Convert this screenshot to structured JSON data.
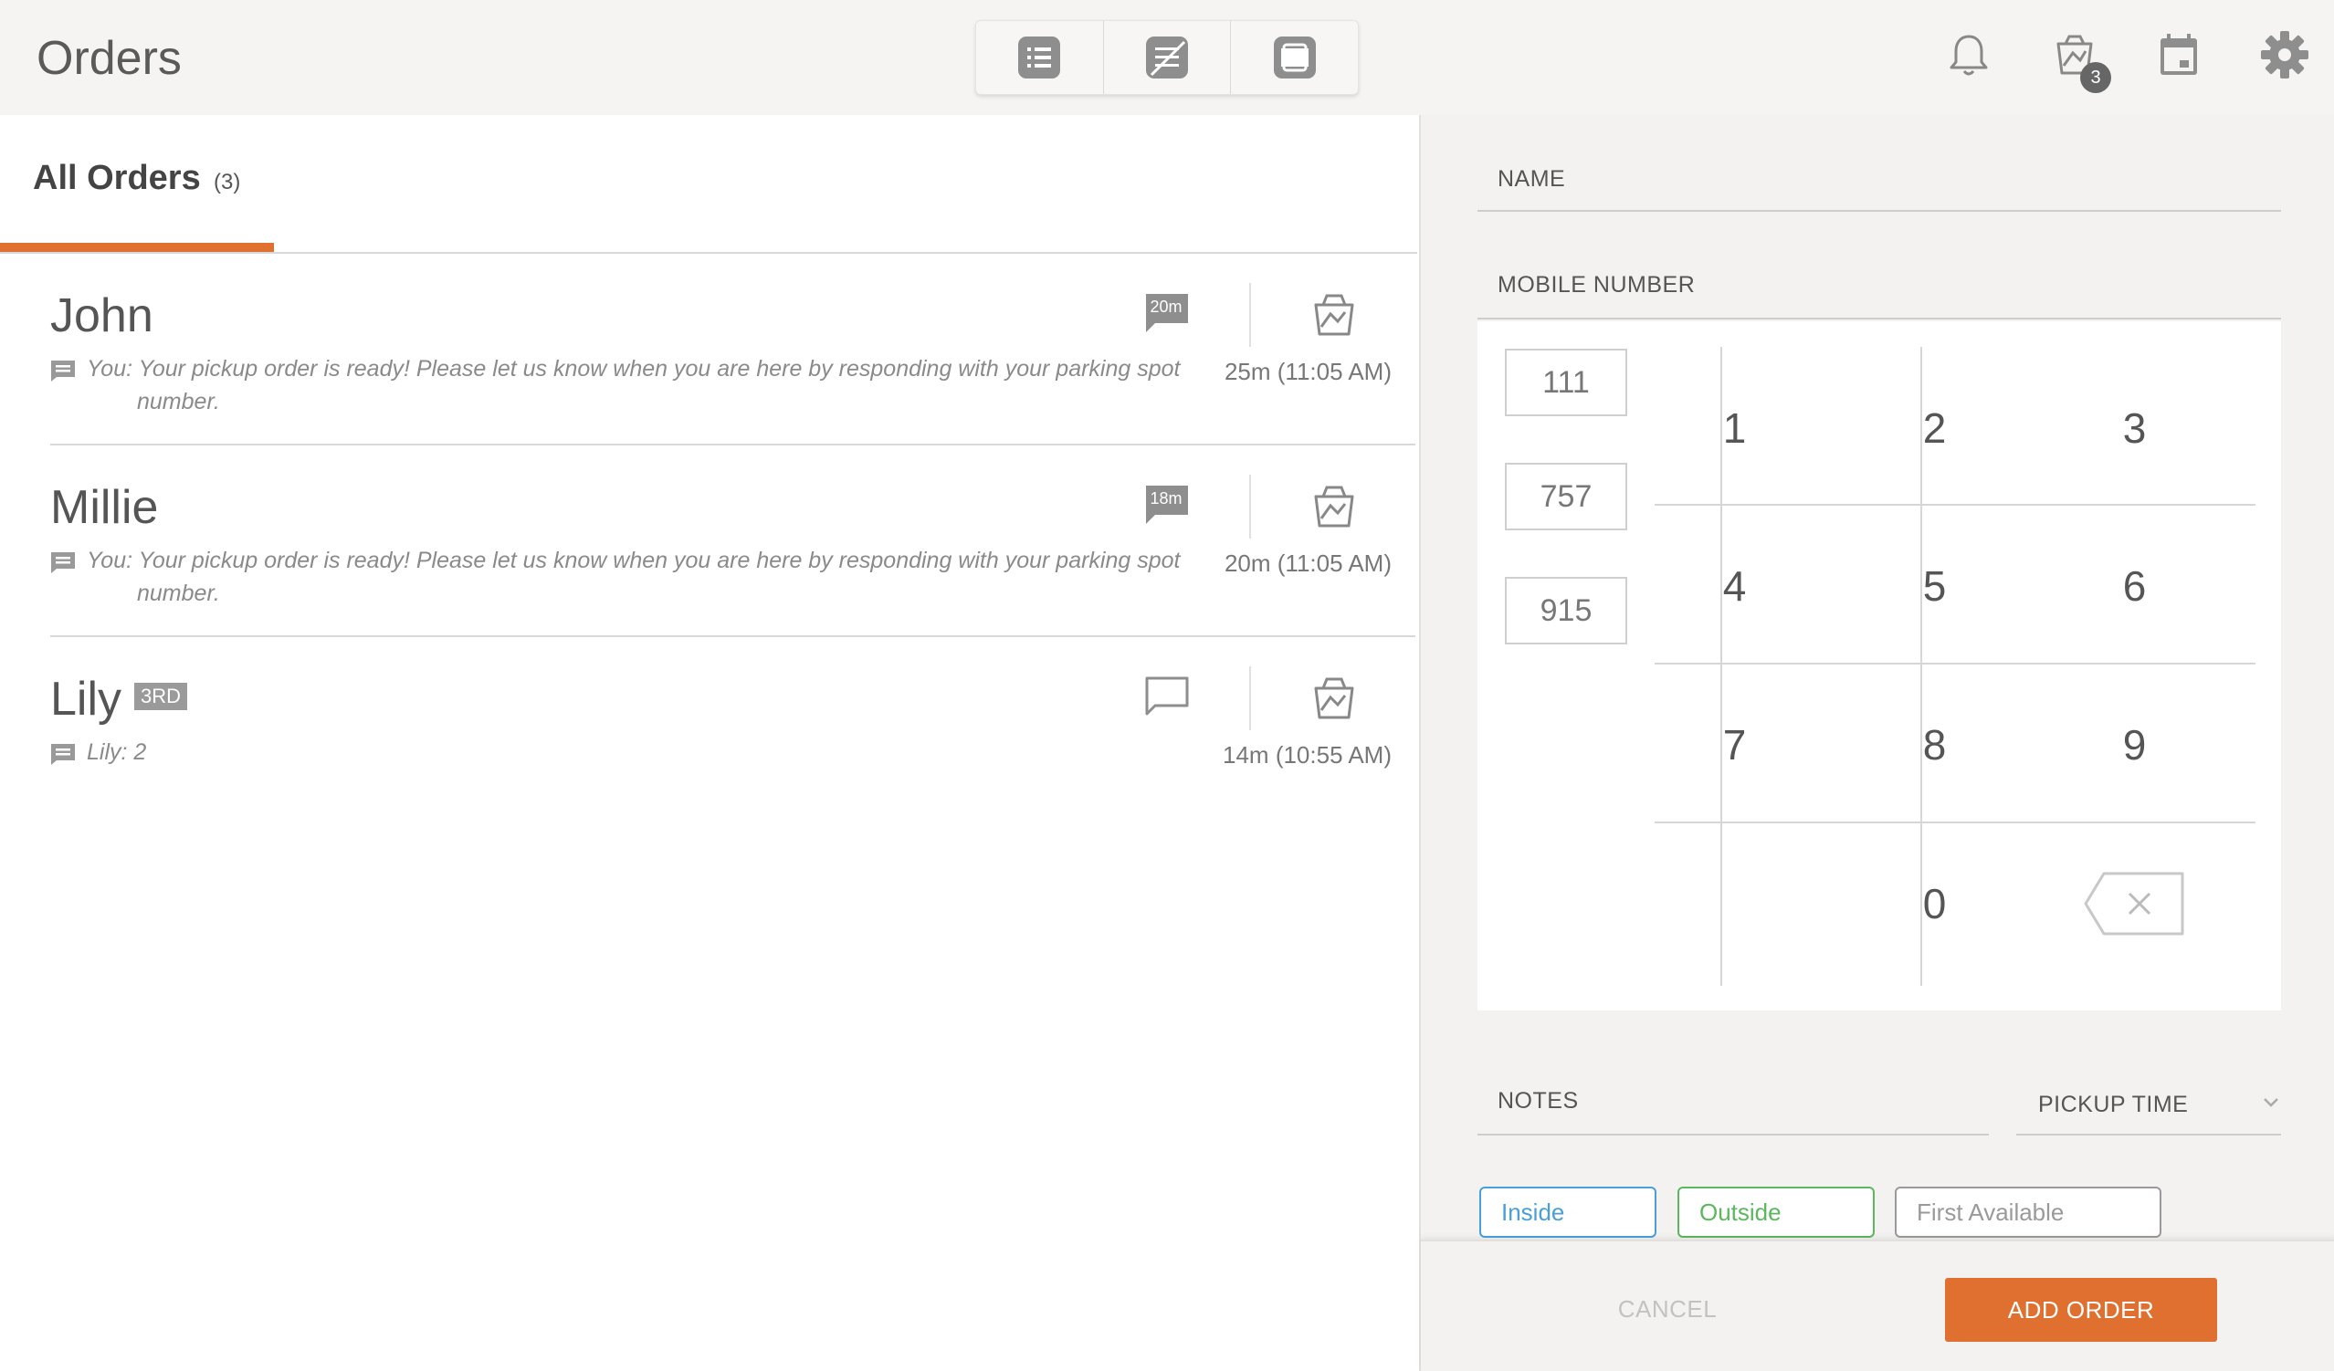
{
  "header": {
    "title": "Orders",
    "notification_badge": "3",
    "view_icons": [
      "list-view-icon",
      "no-image-view-icon",
      "card-view-icon"
    ],
    "right_icons": [
      "bell-icon",
      "pickup-bag-icon",
      "calendar-icon",
      "gear-icon"
    ]
  },
  "tabs": {
    "all_label": "All Orders",
    "all_count": "(3)"
  },
  "orders": [
    {
      "name": "John",
      "badge": "",
      "bubble_time": "20m",
      "message_prefix": "You:",
      "message": "Your pickup order is ready! Please let us know when you are here by responding with your parking spot number.",
      "wait": "25m  (11:05 AM)"
    },
    {
      "name": "Millie",
      "badge": "",
      "bubble_time": "18m",
      "message_prefix": "You:",
      "message": "Your pickup order is ready! Please let us know when you are here by responding with your parking spot number.",
      "wait": "20m  (11:05 AM)"
    },
    {
      "name": "Lily",
      "badge": "3RD",
      "bubble_time": "",
      "message_prefix": "",
      "message": "Lily: 2",
      "wait": "14m  (10:55 AM)"
    }
  ],
  "form": {
    "name_label": "NAME",
    "mobile_label": "MOBILE NUMBER",
    "phone_parts": [
      "111",
      "757",
      "915"
    ],
    "keys": [
      "1",
      "2",
      "3",
      "4",
      "5",
      "6",
      "7",
      "8",
      "9",
      "0"
    ],
    "notes_label": "NOTES",
    "pickup_label": "PICKUP TIME",
    "chips": [
      {
        "label": "Inside",
        "color": "#4a9fd8"
      },
      {
        "label": "Outside",
        "color": "#5cb85c"
      },
      {
        "label": "First Available",
        "color": "#9a9a9a"
      }
    ],
    "cancel_label": "CANCEL",
    "add_label": "ADD ORDER"
  },
  "colors": {
    "accent": "#e07030"
  }
}
